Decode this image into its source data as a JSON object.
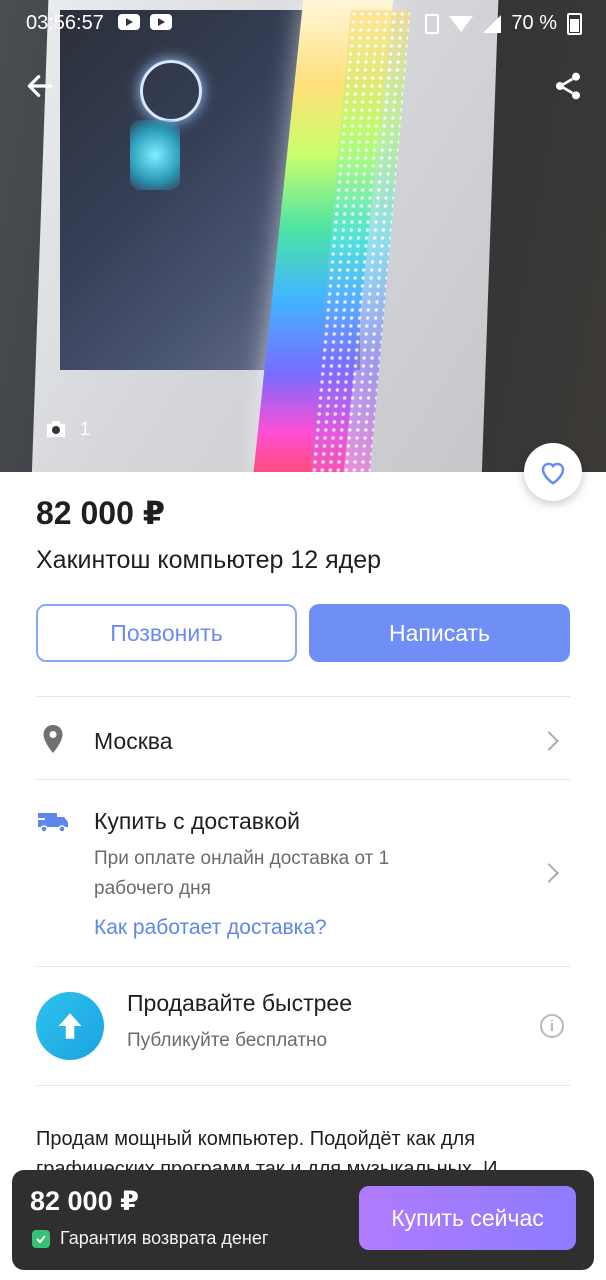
{
  "status_bar": {
    "time": "03:56:57",
    "battery": "70 %"
  },
  "photo": {
    "count": "1"
  },
  "listing": {
    "price": "82 000 ₽",
    "title": "Хакинтош компьютер 12 ядер"
  },
  "actions": {
    "call_label": "Позвонить",
    "write_label": "Написать"
  },
  "location": {
    "city": "Москва"
  },
  "delivery": {
    "title": "Купить с доставкой",
    "description": "При оплате онлайн доставка от 1 рабочего дня",
    "link": "Как работает доставка?"
  },
  "promo": {
    "title": "Продавайте быстрее",
    "subtitle": "Публикуйте бесплатно"
  },
  "description": {
    "text": "Продам мощный компьютер. Подойдёт как для графических программ так и для музыкальных. И"
  },
  "bottom_bar": {
    "price": "82 000 ₽",
    "guarantee": "Гарантия возврата денег",
    "buy_label": "Купить сейчас"
  },
  "colors": {
    "accent": "#6f8ff7",
    "link": "#5f86ee",
    "buy_gradient_start": "#b07bff",
    "promo_blue": "#2fc2ee",
    "guarantee_green": "#38c172"
  },
  "icons": {
    "back": "arrow-left-icon",
    "share": "share-icon",
    "camera": "camera-icon",
    "favorite": "heart-icon",
    "location": "map-pin-icon",
    "delivery": "truck-icon",
    "promo": "arrow-up-icon",
    "info": "info-icon",
    "guarantee": "shield-check-icon"
  }
}
